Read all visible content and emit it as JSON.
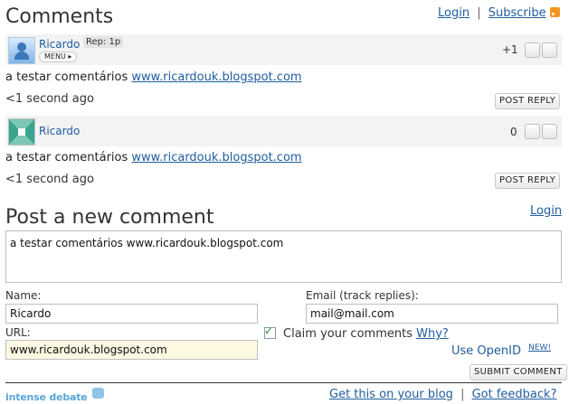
{
  "header": {
    "title": "Comments",
    "login": "Login",
    "separator": "|",
    "subscribe": "Subscribe"
  },
  "comments": [
    {
      "author": "Ricardo",
      "rep": "Rep: 1p",
      "menu": "MENU",
      "score": "+1",
      "text": "a testar comentários",
      "link": "www.ricardouk.blogspot.com",
      "time": "<1 second ago",
      "reply": "POST REPLY"
    },
    {
      "author": "Ricardo",
      "score": "0",
      "text": "a testar comentários",
      "link": "www.ricardouk.blogspot.com",
      "time": "<1 second ago",
      "reply": "POST REPLY"
    }
  ],
  "form": {
    "title": "Post a new comment",
    "login": "Login",
    "comment_value": "a testar comentários www.ricardouk.blogspot.com",
    "name_label": "Name:",
    "name_value": "Ricardo",
    "email_label": "Email (track replies):",
    "email_value": "mail@mail.com",
    "url_label": "URL:",
    "url_value": "www.ricardouk.blogspot.com",
    "claim_label": "Claim your comments",
    "why": "Why?",
    "openid": "Use OpenID",
    "new_badge": "NEW!",
    "submit": "SUBMIT COMMENT"
  },
  "footer": {
    "brand": "intense debate",
    "get_blog": "Get this on your blog",
    "separator": "|",
    "feedback": "Got feedback?"
  },
  "colors": {
    "link": "#1f5d9e",
    "rss": "#f7931e",
    "row_bg": "#f3f3f3",
    "url_field_bg": "#fdf8e1"
  }
}
